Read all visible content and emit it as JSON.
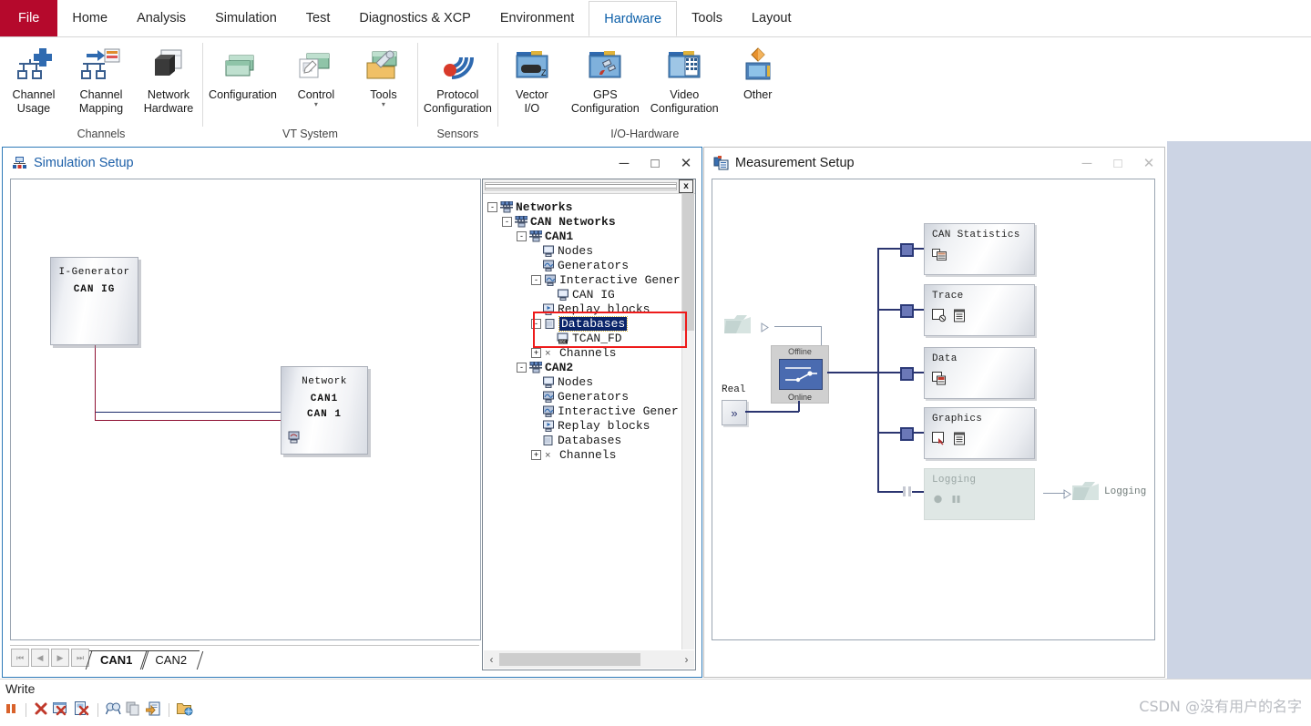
{
  "ribbon": {
    "tabs": [
      {
        "label": "File",
        "kind": "file"
      },
      {
        "label": "Home",
        "kind": "normal"
      },
      {
        "label": "Analysis",
        "kind": "normal"
      },
      {
        "label": "Simulation",
        "kind": "normal"
      },
      {
        "label": "Test",
        "kind": "normal"
      },
      {
        "label": "Diagnostics & XCP",
        "kind": "normal"
      },
      {
        "label": "Environment",
        "kind": "normal"
      },
      {
        "label": "Hardware",
        "kind": "active"
      },
      {
        "label": "Tools",
        "kind": "normal"
      },
      {
        "label": "Layout",
        "kind": "normal"
      }
    ],
    "groups": [
      {
        "name": "Channels",
        "items": [
          {
            "label": "Channel\nUsage",
            "icon": "channel-usage-icon",
            "dropdown": false
          },
          {
            "label": "Channel\nMapping",
            "icon": "channel-mapping-icon",
            "dropdown": false
          },
          {
            "label": "Network\nHardware",
            "icon": "network-hardware-icon",
            "dropdown": false
          }
        ]
      },
      {
        "name": "VT System",
        "items": [
          {
            "label": "Configuration",
            "icon": "vt-configuration-icon",
            "dropdown": false
          },
          {
            "label": "Control",
            "icon": "vt-control-icon",
            "dropdown": true
          },
          {
            "label": "Tools",
            "icon": "vt-tools-icon",
            "dropdown": true
          }
        ]
      },
      {
        "name": "Sensors",
        "items": [
          {
            "label": "Protocol\nConfiguration",
            "icon": "protocol-configuration-icon",
            "dropdown": false
          }
        ]
      },
      {
        "name": "I/O-Hardware",
        "items": [
          {
            "label": "Vector\nI/O",
            "icon": "vector-io-icon",
            "dropdown": false
          },
          {
            "label": "GPS\nConfiguration",
            "icon": "gps-configuration-icon",
            "dropdown": false
          },
          {
            "label": "Video\nConfiguration",
            "icon": "video-configuration-icon",
            "dropdown": false
          },
          {
            "label": "Other",
            "icon": "other-io-icon",
            "dropdown": false
          }
        ]
      }
    ]
  },
  "simulation_setup": {
    "title": "Simulation Setup",
    "window_buttons": {
      "minimize": "─",
      "maximize": "□",
      "close": "✕"
    },
    "blocks": [
      {
        "line1": "I-Generator",
        "line2": "CAN IG",
        "line3": ""
      },
      {
        "line1": "Network",
        "line2": "CAN1",
        "line3": "CAN 1"
      }
    ],
    "sheet_tabs": [
      {
        "label": "CAN1",
        "selected": true
      },
      {
        "label": "CAN2",
        "selected": false
      }
    ],
    "nav_buttons": [
      "first",
      "previous",
      "next",
      "last"
    ]
  },
  "tree": {
    "close_button": "x",
    "nodes": [
      {
        "indent": 0,
        "toggle": "-",
        "icon": "network-group-icon",
        "label": "Networks",
        "bold": true,
        "selected": false
      },
      {
        "indent": 1,
        "toggle": "-",
        "icon": "network-group-icon",
        "label": "CAN Networks",
        "bold": true,
        "selected": false
      },
      {
        "indent": 2,
        "toggle": "-",
        "icon": "network-group-icon",
        "label": "CAN1",
        "bold": true,
        "selected": false
      },
      {
        "indent": 3,
        "toggle": "",
        "icon": "node-icon",
        "label": "Nodes",
        "bold": false,
        "selected": false
      },
      {
        "indent": 3,
        "toggle": "",
        "icon": "generator-icon",
        "label": "Generators",
        "bold": false,
        "selected": false
      },
      {
        "indent": 3,
        "toggle": "-",
        "icon": "generator-icon",
        "label": "Interactive Gener",
        "bold": false,
        "selected": false
      },
      {
        "indent": 4,
        "toggle": "",
        "icon": "node-icon",
        "label": "CAN IG",
        "bold": false,
        "selected": false
      },
      {
        "indent": 3,
        "toggle": "",
        "icon": "replay-icon",
        "label": "Replay blocks",
        "bold": false,
        "selected": false
      },
      {
        "indent": 3,
        "toggle": "-",
        "icon": "database-icon",
        "label": "Databases",
        "bold": false,
        "selected": true
      },
      {
        "indent": 4,
        "toggle": "",
        "icon": "dbc-icon",
        "label": "TCAN_FD",
        "bold": false,
        "selected": false
      },
      {
        "indent": 3,
        "toggle": "+",
        "icon": "channels-icon",
        "label": "Channels",
        "bold": false,
        "selected": false
      },
      {
        "indent": 2,
        "toggle": "-",
        "icon": "network-group-icon",
        "label": "CAN2",
        "bold": true,
        "selected": false
      },
      {
        "indent": 3,
        "toggle": "",
        "icon": "node-icon",
        "label": "Nodes",
        "bold": false,
        "selected": false
      },
      {
        "indent": 3,
        "toggle": "",
        "icon": "generator-icon",
        "label": "Generators",
        "bold": false,
        "selected": false
      },
      {
        "indent": 3,
        "toggle": "",
        "icon": "generator-icon",
        "label": "Interactive Gener",
        "bold": false,
        "selected": false
      },
      {
        "indent": 3,
        "toggle": "",
        "icon": "replay-icon",
        "label": "Replay blocks",
        "bold": false,
        "selected": false
      },
      {
        "indent": 3,
        "toggle": "",
        "icon": "database-icon",
        "label": "Databases",
        "bold": false,
        "selected": false
      },
      {
        "indent": 3,
        "toggle": "+",
        "icon": "channels-icon",
        "label": "Channels",
        "bold": false,
        "selected": false
      }
    ],
    "scroll_left": "‹",
    "scroll_right": "›"
  },
  "measurement_setup": {
    "title": "Measurement Setup",
    "window_buttons": {
      "minimize": "─",
      "maximize": "□",
      "close": "✕"
    },
    "switch": {
      "top_label": "Offline",
      "bottom_label": "Online"
    },
    "real_label": "Real",
    "real_button": "»",
    "logging_export_label": "Logging",
    "blocks": [
      {
        "label": "CAN Statistics",
        "disabled": false,
        "icons": [
          "statistics-icon"
        ]
      },
      {
        "label": "Trace",
        "disabled": false,
        "icons": [
          "trace-window-icon",
          "list-icon"
        ]
      },
      {
        "label": "Data",
        "disabled": false,
        "icons": [
          "data-window-icon"
        ]
      },
      {
        "label": "Graphics",
        "disabled": false,
        "icons": [
          "graphics-window-icon",
          "list-icon"
        ]
      },
      {
        "label": "Logging",
        "disabled": true,
        "icons": [
          "record-icon",
          "pause-icon"
        ]
      }
    ]
  },
  "status": {
    "write_label": "Write",
    "toolbar_icons": [
      "pause-icon",
      "clear-icon",
      "clear-all-icon",
      "save-clear-icon",
      "find-icon",
      "copy-icon",
      "export-icon",
      "open-folder-icon"
    ]
  },
  "watermark": "CSDN @没有用户的名字",
  "colors": {
    "file_tab": "#b5092c",
    "active_tab_text": "#0b5ea8",
    "selection": "#0a246a",
    "highlight_box": "#ee1b1b",
    "wire_blue": "#1c2b6b",
    "wire_red": "#8e1032"
  }
}
